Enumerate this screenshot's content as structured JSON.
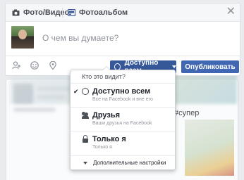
{
  "composer": {
    "tab_photo": "Фото/Видео",
    "tab_album": "Фотоальбом",
    "placeholder": "О чем вы думаете?",
    "audience_label": "Доступно всем",
    "publish_label": "Опубликовать"
  },
  "audience_menu": {
    "header": "Кто это видит?",
    "items": [
      {
        "title": "Доступно всем",
        "subtitle": "Все на Facebook и вне его",
        "selected": true,
        "icon": "globe-icon"
      },
      {
        "title": "Друзья",
        "subtitle": "Ваши друзья на Facebook",
        "selected": false,
        "icon": "friends-icon"
      },
      {
        "title": "Только я",
        "subtitle": "Только я",
        "selected": false,
        "icon": "lock-icon"
      }
    ],
    "more_label": "Дополнительные настройки"
  },
  "feed": {
    "hashtag": "#супер"
  },
  "colors": {
    "accent": "#4267b2",
    "audience_button": "#365899",
    "background": "#e9ebee"
  }
}
